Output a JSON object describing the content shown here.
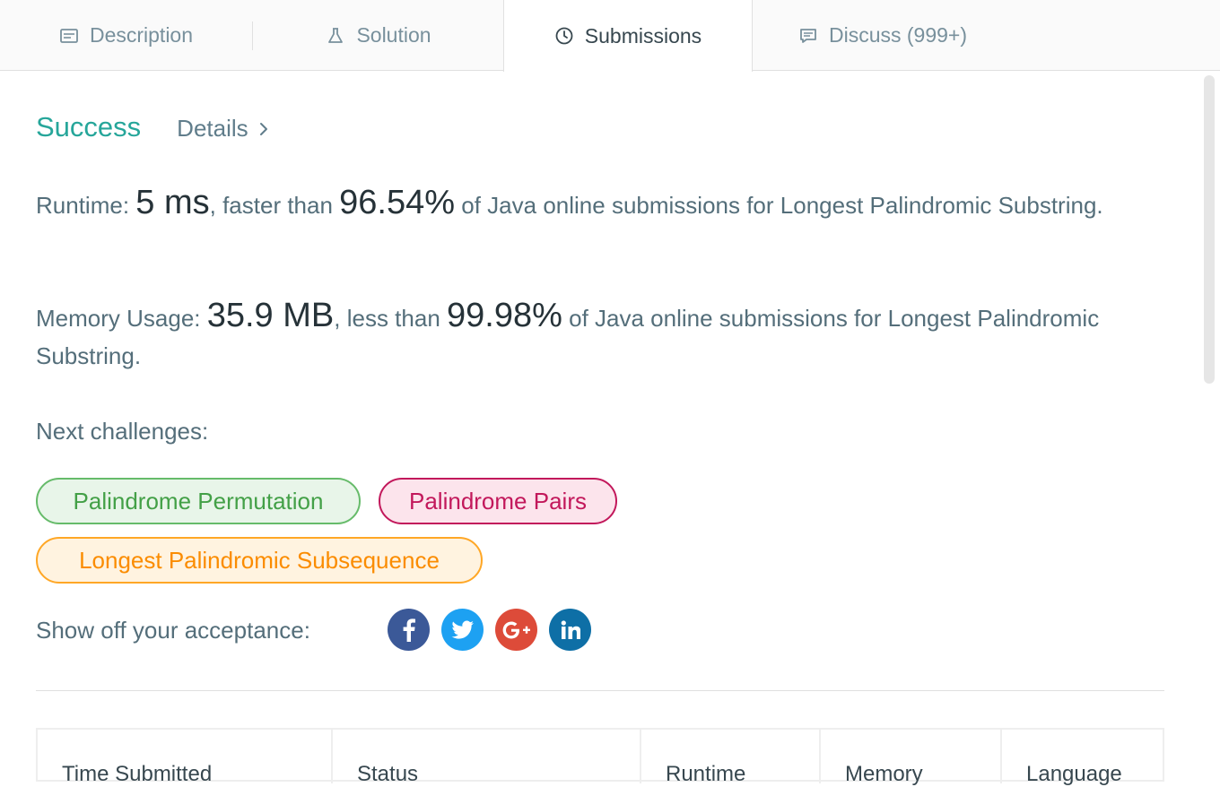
{
  "tabs": [
    {
      "label": "Description",
      "icon": "description-icon"
    },
    {
      "label": "Solution",
      "icon": "flask-icon"
    },
    {
      "label": "Submissions",
      "icon": "clock-icon"
    },
    {
      "label": "Discuss (999+)",
      "icon": "comment-icon"
    }
  ],
  "active_tab": "Submissions",
  "result": {
    "status": "Success",
    "details_label": "Details"
  },
  "runtime": {
    "prefix": "Runtime: ",
    "value": "5 ms",
    "mid": ", faster than ",
    "percent": "96.54%",
    "suffix": " of Java online submissions for Longest Palindromic Substring."
  },
  "memory": {
    "prefix": "Memory Usage: ",
    "value": "35.9 MB",
    "mid": ", less than ",
    "percent": "99.98%",
    "suffix": " of Java online submissions for Longest Palindromic Substring."
  },
  "next_challenges": {
    "label": "Next challenges:",
    "items": [
      {
        "label": "Palindrome Permutation",
        "color": "#43a047"
      },
      {
        "label": "Palindrome Pairs",
        "color": "#c2185b"
      },
      {
        "label": "Longest Palindromic Subsequence",
        "color": "#fb8c00"
      }
    ]
  },
  "share": {
    "label": "Show off your acceptance:",
    "networks": [
      {
        "name": "facebook-icon",
        "color": "#3b5998"
      },
      {
        "name": "twitter-icon",
        "color": "#1da1f2"
      },
      {
        "name": "google-plus-icon",
        "color": "#dd4b39"
      },
      {
        "name": "linkedin-icon",
        "color": "#0e6fa6"
      }
    ]
  },
  "table": {
    "headers": [
      "Time Submitted",
      "Status",
      "Runtime",
      "Memory",
      "Language"
    ]
  }
}
